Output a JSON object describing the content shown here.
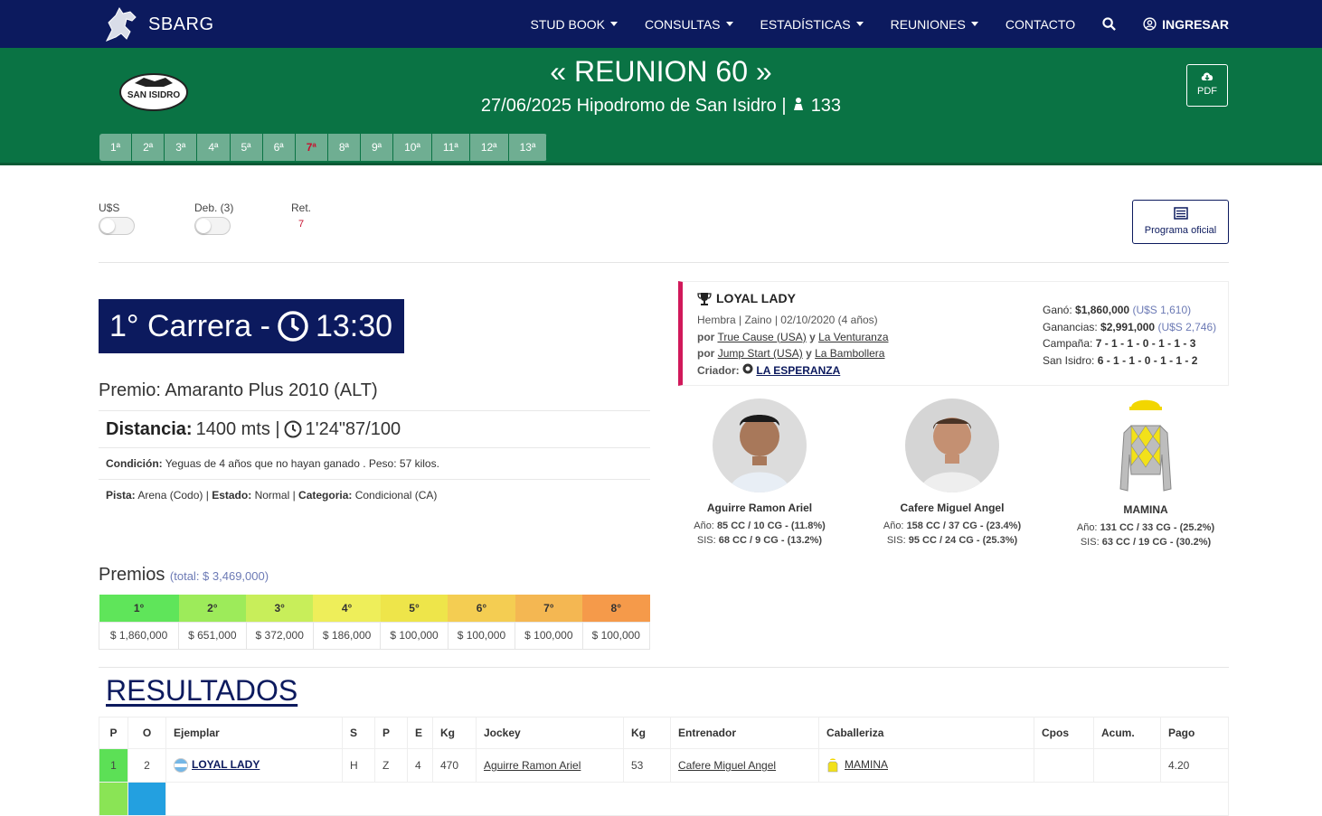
{
  "brand": {
    "name": "SBARG"
  },
  "nav": {
    "items": [
      "STUD BOOK",
      "CONSULTAS",
      "ESTADÍSTICAS",
      "REUNIONES",
      "CONTACTO"
    ],
    "login": "INGRESAR"
  },
  "header": {
    "logo_text": "SAN ISIDRO",
    "title": "« REUNION 60 »",
    "subtitle": "27/06/2025 Hipodromo de San Isidro | ",
    "count": "133",
    "pdf_label": "PDF",
    "races": [
      "1ª",
      "2ª",
      "3ª",
      "4ª",
      "5ª",
      "6ª",
      "7ª",
      "8ª",
      "9ª",
      "10ª",
      "11ª",
      "12ª",
      "13ª"
    ],
    "active_race_index": 6
  },
  "toggles": {
    "usd": "U$S",
    "deb": "Deb. (3)",
    "ret_label": "Ret.",
    "ret_value": "7",
    "programa": "Programa oficial"
  },
  "race": {
    "carrera": "1° Carrera -",
    "time": "13:30",
    "premio": "Premio: Amaranto Plus 2010 (ALT)",
    "dist_label": "Distancia:",
    "dist_value": "1400 mts |",
    "record": "1'24\"87/100",
    "cond_label": "Condición:",
    "cond_value": "Yeguas de 4 años que no hayan ganado . Peso: 57 kilos.",
    "pista_label": "Pista:",
    "pista_value": "Arena (Codo) |",
    "estado_label": "Estado:",
    "estado_value": "Normal |",
    "categoria_label": "Categoria:",
    "categoria_value": "Condicional (CA)"
  },
  "premios": {
    "title": "Premios",
    "total": "(total: $ 3,469,000)",
    "places": [
      "1°",
      "2°",
      "3°",
      "4°",
      "5°",
      "6°",
      "7°",
      "8°"
    ],
    "amounts": [
      "$ 1,860,000",
      "$ 651,000",
      "$ 372,000",
      "$ 186,000",
      "$ 100,000",
      "$ 100,000",
      "$ 100,000",
      "$ 100,000"
    ],
    "colors": [
      "#5fe55a",
      "#9deb5a",
      "#c8ee5a",
      "#eeee5a",
      "#eee54a",
      "#f4cd52",
      "#f4b752",
      "#f59a4a"
    ]
  },
  "winner": {
    "name": "LOYAL LADY",
    "desc": "Hembra | Zaino | 02/10/2020 (4 años)",
    "por": "por",
    "y": "y",
    "sire": "True Cause (USA)",
    "dam": "La Venturanza",
    "damsire": "Jump Start (USA)",
    "granddam": "La Bambollera",
    "criador_label": "Criador:",
    "criador": "LA ESPERANZA",
    "gano_label": "Ganó:",
    "gano": "$1,860,000",
    "gano_usd": "(U$S 1,610)",
    "ganancias_label": "Ganancias:",
    "ganancias": "$2,991,000",
    "ganancias_usd": "(U$S 2,746)",
    "campana_label": "Campaña:",
    "campana": "7 - 1 - 1 - 0 - 1 - 1 - 3",
    "si_label": "San Isidro:",
    "si": "6 - 1 - 1 - 0 - 1 - 1 - 2"
  },
  "people": [
    {
      "name": "Aguirre Ramon Ariel",
      "ano_label": "Año:",
      "ano": "85 CC / 10 CG - (11.8%)",
      "sis_label": "SIS:",
      "sis": "68 CC / 9 CG - (13.2%)"
    },
    {
      "name": "Cafere Miguel Angel",
      "ano_label": "Año:",
      "ano": "158 CC / 37 CG - (23.4%)",
      "sis_label": "SIS:",
      "sis": "95 CC / 24 CG - (25.3%)"
    },
    {
      "name": "MAMINA",
      "ano_label": "Año:",
      "ano": "131 CC / 33 CG - (25.2%)",
      "sis_label": "SIS:",
      "sis": "63 CC / 19 CG - (30.2%)"
    }
  ],
  "resultados": {
    "title": "RESULTADOS",
    "columns": [
      "P",
      "O",
      "Ejemplar",
      "S",
      "P",
      "E",
      "Kg",
      "Jockey",
      "Kg",
      "Entrenador",
      "Caballeriza",
      "Cpos",
      "Acum.",
      "Pago"
    ],
    "rows": [
      {
        "p": "1",
        "o": "2",
        "ejemplar": "LOYAL LADY",
        "s": "H",
        "pe": "Z",
        "e": "4",
        "kg": "470",
        "jockey": "Aguirre Ramon Ariel",
        "kg2": "53",
        "entrenador": "Cafere Miguel Angel",
        "caballeriza": "MAMINA",
        "cpos": "",
        "acum": "",
        "pago": "4.20"
      }
    ]
  }
}
